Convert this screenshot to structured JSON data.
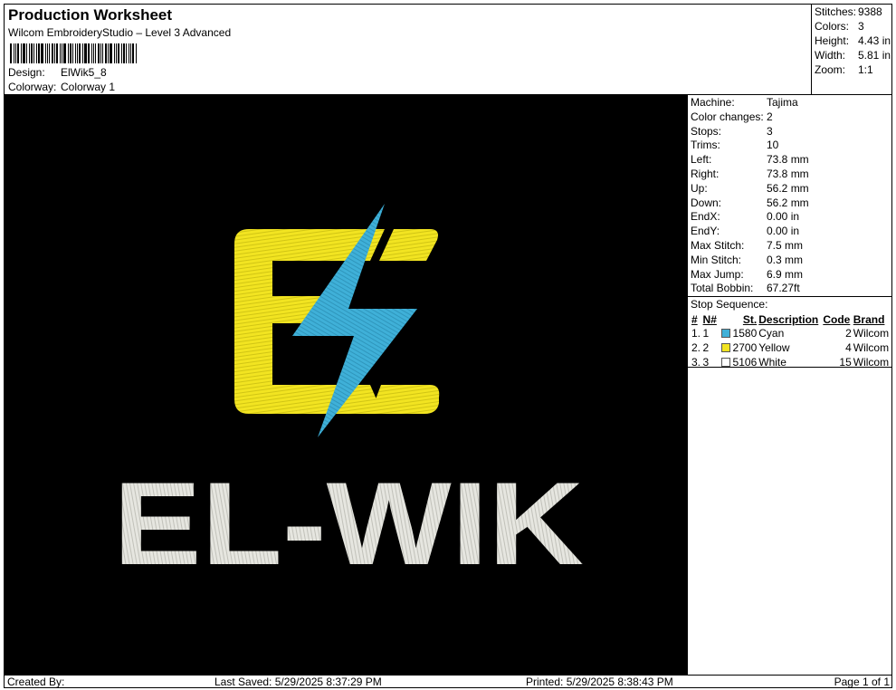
{
  "header": {
    "title": "Production Worksheet",
    "subtitle": "Wilcom EmbroideryStudio – Level 3 Advanced",
    "design_label": "Design:",
    "design_value": "ElWik5_8",
    "colorway_label": "Colorway:",
    "colorway_value": "Colorway 1"
  },
  "summary": {
    "stitches_label": "Stitches:",
    "stitches_value": "9388",
    "colors_label": "Colors:",
    "colors_value": "3",
    "height_label": "Height:",
    "height_value": "4.43 in",
    "width_label": "Width:",
    "width_value": "5.81 in",
    "zoom_label": "Zoom:",
    "zoom_value": "1:1"
  },
  "design": {
    "logo_text": "EL-WIK",
    "colors": {
      "yellow": "#f2e421",
      "cyan": "#3fb0d8",
      "white": "#e6e6e0",
      "background": "#000000"
    }
  },
  "info": [
    {
      "label": "Machine:",
      "value": "Tajima"
    },
    {
      "label": "Color changes:",
      "value": "2"
    },
    {
      "label": "Stops:",
      "value": "3"
    },
    {
      "label": "Trims:",
      "value": "10"
    },
    {
      "label": "Left:",
      "value": "73.8 mm"
    },
    {
      "label": "Right:",
      "value": "73.8 mm"
    },
    {
      "label": "Up:",
      "value": "56.2 mm"
    },
    {
      "label": "Down:",
      "value": "56.2 mm"
    },
    {
      "label": "EndX:",
      "value": "0.00 in"
    },
    {
      "label": "EndY:",
      "value": "0.00 in"
    },
    {
      "label": "Max Stitch:",
      "value": "7.5 mm"
    },
    {
      "label": "Min Stitch:",
      "value": "0.3 mm"
    },
    {
      "label": "Max Jump:",
      "value": "6.9 mm"
    },
    {
      "label": "Total Bobbin:",
      "value": "67.27ft"
    }
  ],
  "stop_sequence": {
    "title": "Stop Sequence:",
    "headers": {
      "num": "#",
      "needle": "N#",
      "stitches": "St.",
      "description": "Description",
      "code": "Code",
      "brand": "Brand"
    },
    "rows": [
      {
        "num": "1.",
        "needle": "1",
        "color": "#3fb0d8",
        "stitches": "1580",
        "description": "Cyan",
        "code": "2",
        "brand": "Wilcom"
      },
      {
        "num": "2.",
        "needle": "2",
        "color": "#f2e421",
        "stitches": "2700",
        "description": "Yellow",
        "code": "4",
        "brand": "Wilcom"
      },
      {
        "num": "3.",
        "needle": "3",
        "color": "#ffffff",
        "stitches": "5106",
        "description": "White",
        "code": "15",
        "brand": "Wilcom"
      }
    ]
  },
  "footer": {
    "created_by": "Created By:",
    "last_saved": "Last Saved: 5/29/2025 8:37:29 PM",
    "printed": "Printed: 5/29/2025 8:38:43 PM",
    "page": "Page 1 of 1"
  }
}
